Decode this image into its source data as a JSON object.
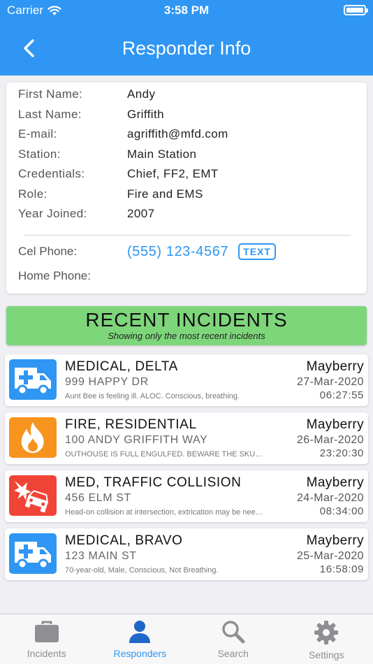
{
  "status_bar": {
    "carrier": "Carrier",
    "time": "3:58 PM"
  },
  "header": {
    "title": "Responder Info",
    "back_icon": "chevron-left-icon"
  },
  "responder": {
    "fields": [
      {
        "label": "First Name:",
        "value": "Andy"
      },
      {
        "label": "Last Name:",
        "value": "Griffith"
      },
      {
        "label": "E-mail:",
        "value": "agriffith@mfd.com"
      },
      {
        "label": "Station:",
        "value": "Main Station"
      },
      {
        "label": "Credentials:",
        "value": "Chief, FF2, EMT"
      },
      {
        "label": "Role:",
        "value": "Fire and EMS"
      },
      {
        "label": "Year Joined:",
        "value": "2007"
      }
    ],
    "cel_phone_label": "Cel Phone:",
    "cel_phone_value": "(555) 123-4567",
    "text_button": "TEXT",
    "home_phone_label": "Home Phone:"
  },
  "recent_incidents": {
    "title": "RECENT INCIDENTS",
    "subtitle": "Showing only the most recent incidents",
    "items": [
      {
        "type": "MEDICAL, DELTA",
        "address": "999 HAPPY DR",
        "note": "Aunt Bee is feeling ill.  ALOC.  Conscious, breathing.",
        "city": "Mayberry",
        "date": "27-Mar-2020",
        "time": "06:27:55",
        "icon": "ambulance-icon",
        "color": "#2f96f3"
      },
      {
        "type": "FIRE, RESIDENTIAL",
        "address": "100 ANDY GRIFFITH WAY",
        "note": "OUTHOUSE IS FULL ENGULFED.  BEWARE THE SKUNK.",
        "city": "Mayberry",
        "date": "26-Mar-2020",
        "time": "23:20:30",
        "icon": "fire-icon",
        "color": "#f7941d"
      },
      {
        "type": "MED, TRAFFIC COLLISION",
        "address": "456 ELM ST",
        "note": "Head-on collision at intersection, extrication may be needed.",
        "city": "Mayberry",
        "date": "24-Mar-2020",
        "time": "08:34:00",
        "icon": "car-crash-icon",
        "color": "#f04438"
      },
      {
        "type": "MEDICAL, BRAVO",
        "address": "123 MAIN ST",
        "note": "70-year-old, Male, Conscious, Not Breathing.",
        "city": "Mayberry",
        "date": "25-Mar-2020",
        "time": "16:58:09",
        "icon": "ambulance-icon",
        "color": "#2f96f3"
      }
    ]
  },
  "tabs": [
    {
      "label": "Incidents",
      "icon": "briefcase-icon",
      "active": false
    },
    {
      "label": "Responders",
      "icon": "person-icon",
      "active": true
    },
    {
      "label": "Search",
      "icon": "search-icon",
      "active": false
    },
    {
      "label": "Settings",
      "icon": "gear-icon",
      "active": false
    }
  ],
  "colors": {
    "accent": "#2f96f3",
    "banner": "#7ed67a",
    "tab_inactive": "#8e8e93"
  }
}
